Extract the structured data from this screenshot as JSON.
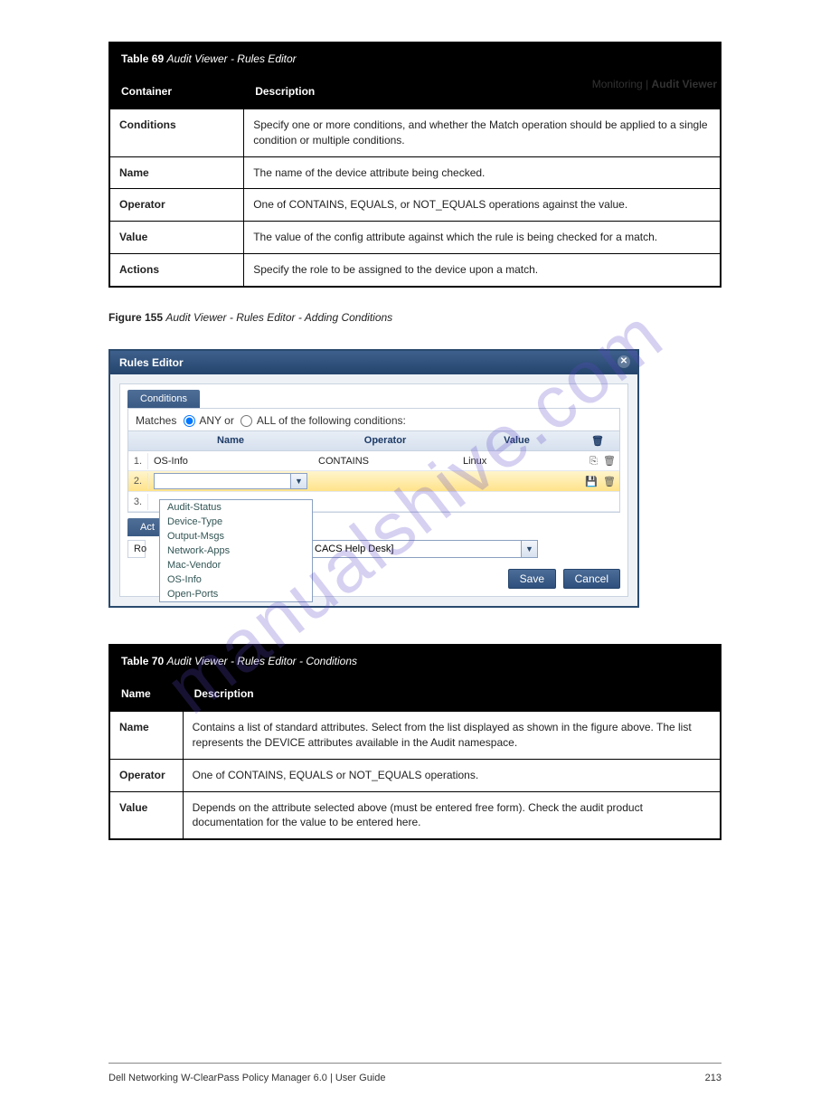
{
  "header_right": {
    "section": "Monitoring",
    "page_title": "Audit Viewer"
  },
  "table1": {
    "caption": {
      "strong": "Table 69",
      "rest": "  Audit Viewer - Rules Editor"
    },
    "col_headers": [
      "Container",
      "Description"
    ],
    "rows": [
      {
        "c1": "Conditions",
        "c2": "Specify one or more conditions, and whether the Match operation should be applied to a single condition or multiple conditions."
      },
      {
        "c1": "Name",
        "c2": "The name of the device attribute being checked."
      },
      {
        "c1": "Operator",
        "c2": "One of CONTAINS, EQUALS, or NOT_EQUALS operations against the value."
      },
      {
        "c1": "Value",
        "c2": "The value of the config attribute against which the rule is being checked for a match."
      },
      {
        "c1": "Actions",
        "c2": "Specify the role to be assigned to the device upon a match."
      }
    ]
  },
  "figure_caption": {
    "strong": "Figure 155",
    "rest": "  Audit Viewer - Rules Editor - Adding Conditions"
  },
  "rules_editor": {
    "title": "Rules Editor",
    "conditions_tab": "Conditions",
    "actions_tab": "Act",
    "matches_prefix": "Matches",
    "any_label": "ANY or",
    "all_label": "ALL of the following conditions:",
    "headers": {
      "name": "Name",
      "operator": "Operator",
      "value": "Value"
    },
    "rows": [
      {
        "num": "1.",
        "name": "OS-Info",
        "op": "CONTAINS",
        "val": "Linux"
      },
      {
        "num": "2."
      },
      {
        "num": "3."
      }
    ],
    "dropdown_options": [
      "Audit-Status",
      "Device-Type",
      "Output-Msgs",
      "Network-Apps",
      "Mac-Vendor",
      "OS-Info",
      "Open-Ports"
    ],
    "ro_label": "Ro",
    "action_value": "CACS Help Desk]",
    "save": "Save",
    "cancel": "Cancel"
  },
  "table2": {
    "caption": {
      "strong": "Table 70",
      "rest": "  Audit Viewer - Rules Editor - Conditions"
    },
    "col_headers": [
      "Name",
      "Description"
    ],
    "rows": [
      {
        "c1": "Name",
        "c2": "Contains a list of standard attributes. Select from the list displayed as shown in the figure above. The list represents the DEVICE attributes available in the Audit namespace."
      },
      {
        "c1": "Operator",
        "c2": "One of CONTAINS, EQUALS or NOT_EQUALS operations."
      },
      {
        "c1": "Value",
        "c2": "Depends on the attribute selected above (must be entered free form). Check the audit product documentation for the value to be entered here."
      }
    ]
  },
  "watermark": "manualshive.com",
  "footer": {
    "left": "Dell Networking W-ClearPass Policy Manager 6.0 | User Guide",
    "right_num": "213"
  }
}
